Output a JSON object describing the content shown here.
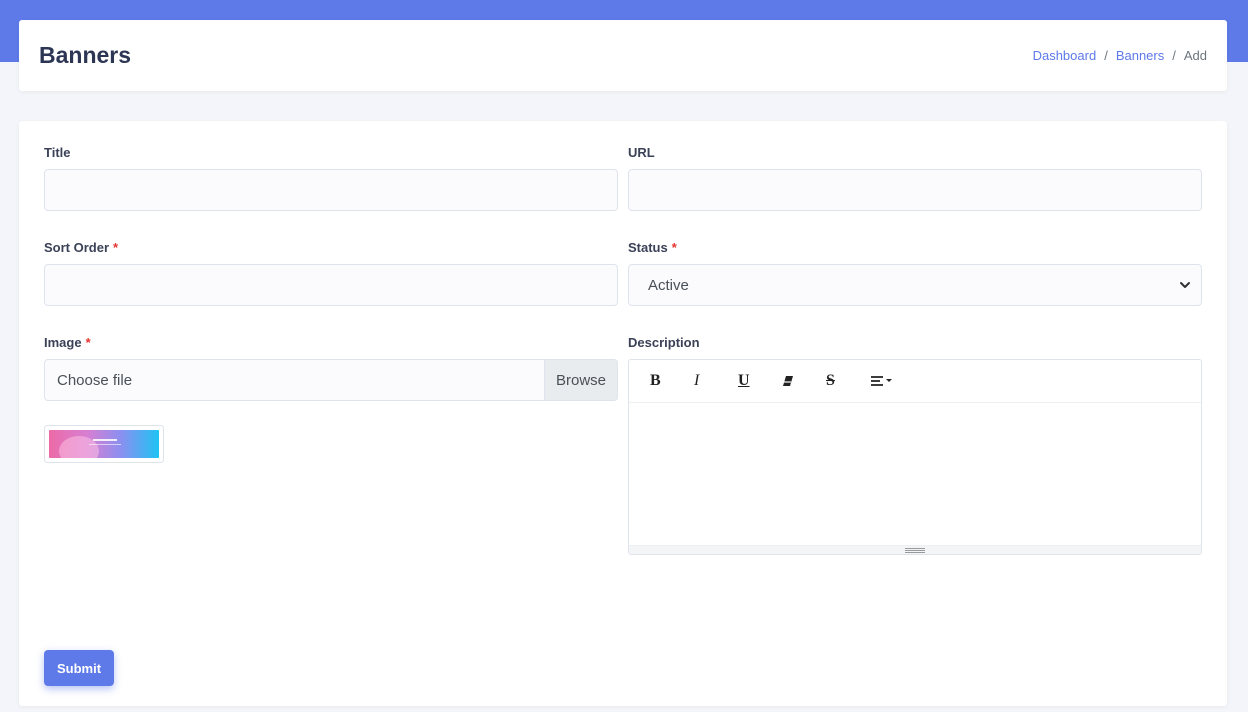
{
  "header": {
    "title": "Banners",
    "breadcrumb": [
      "Dashboard",
      "Banners",
      "Add"
    ],
    "separator": "/"
  },
  "form": {
    "title": {
      "label": "Title",
      "value": ""
    },
    "url": {
      "label": "URL",
      "value": ""
    },
    "sort_order": {
      "label": "Sort Order",
      "required": "*",
      "value": ""
    },
    "status": {
      "label": "Status",
      "required": "*",
      "value": "Active"
    },
    "image": {
      "label": "Image",
      "required": "*",
      "file_text": "Choose file",
      "browse_label": "Browse"
    },
    "description": {
      "label": "Description",
      "toolbar": [
        "bold-icon",
        "italic-icon",
        "underline-icon",
        "eraser-icon",
        "strikethrough-icon",
        "align-icon"
      ]
    },
    "submit_label": "Submit"
  },
  "colors": {
    "accent": "#5e7ae8",
    "required": "#e3342f",
    "background": "#f4f5fa"
  }
}
